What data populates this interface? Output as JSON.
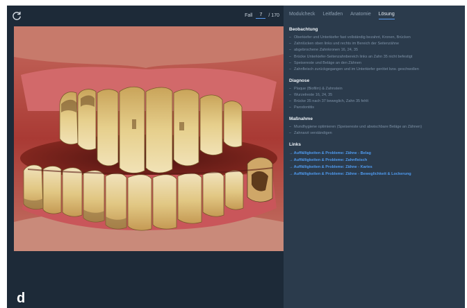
{
  "viewer": {
    "refresh_icon": "refresh-icon",
    "case_label": "Fall",
    "case_number": "7",
    "case_total": "/ 170",
    "figure_letter": "d"
  },
  "tabs": [
    {
      "label": "Modulcheck",
      "active": false
    },
    {
      "label": "Leitfaden",
      "active": false
    },
    {
      "label": "Anatomie",
      "active": false
    },
    {
      "label": "Lösung",
      "active": true
    }
  ],
  "sections": [
    {
      "title": "Beobachtung",
      "items": [
        "Oberkiefer und Unterkiefer fast vollständig bezahnt, Kronen, Brücken",
        "Zahnlücken oben links und rechts im Bereich der Seitenzähne",
        "abgebrochene Zahnkronen 16, 24, 35",
        "Brücke Unterkiefer-Seitenzahnbereich links an Zahn 35 nicht befestigt",
        "Speisereste und Beläge an den Zähnen",
        "Zahnfleisch zurückgegangen und im Unterkiefer gerötet bzw. geschwollen"
      ]
    },
    {
      "title": "Diagnose",
      "items": [
        "Plaque (Biofilm) & Zahnstein",
        "Wurzelreste 16, 24, 35",
        "Brücke 35 nach 37 beweglich, Zahn 35 fehlt",
        "Parodontitis"
      ]
    },
    {
      "title": "Maßnahme",
      "items": [
        "Mundhygiene optimieren (Speisereste und abwischbare Beläge an Zähnen)",
        "Zahnarzt verständigen"
      ]
    }
  ],
  "links": {
    "title": "Links",
    "items": [
      "Auffälligkeiten & Probleme: Zähne - Belag",
      "Auffälligkeiten & Probleme: Zahnfleisch",
      "Auffälligkeiten & Probleme: Zähne - Karies",
      "Auffälligkeiten & Probleme: Zähne - Beweglichkeit & Lockerung"
    ]
  },
  "colors": {
    "panel_bg": "#2b3b4c",
    "viewer_bg": "#1d2a38",
    "accent": "#5a9cf0",
    "link": "#4f9bf0",
    "muted_text": "#7d91a6"
  }
}
